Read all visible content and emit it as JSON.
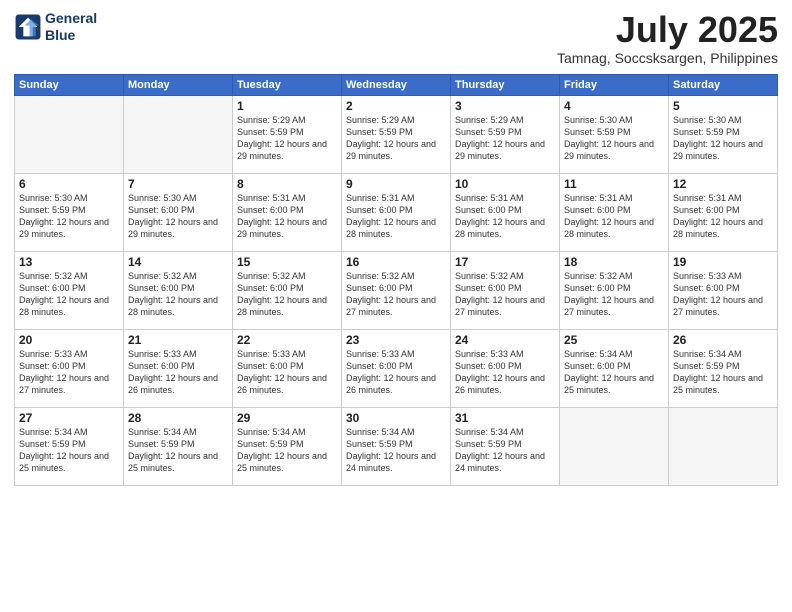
{
  "logo": {
    "line1": "General",
    "line2": "Blue"
  },
  "title": "July 2025",
  "location": "Tamnag, Soccsksargen, Philippines",
  "header_days": [
    "Sunday",
    "Monday",
    "Tuesday",
    "Wednesday",
    "Thursday",
    "Friday",
    "Saturday"
  ],
  "weeks": [
    [
      {
        "day": "",
        "info": ""
      },
      {
        "day": "",
        "info": ""
      },
      {
        "day": "1",
        "info": "Sunrise: 5:29 AM\nSunset: 5:59 PM\nDaylight: 12 hours\nand 29 minutes."
      },
      {
        "day": "2",
        "info": "Sunrise: 5:29 AM\nSunset: 5:59 PM\nDaylight: 12 hours\nand 29 minutes."
      },
      {
        "day": "3",
        "info": "Sunrise: 5:29 AM\nSunset: 5:59 PM\nDaylight: 12 hours\nand 29 minutes."
      },
      {
        "day": "4",
        "info": "Sunrise: 5:30 AM\nSunset: 5:59 PM\nDaylight: 12 hours\nand 29 minutes."
      },
      {
        "day": "5",
        "info": "Sunrise: 5:30 AM\nSunset: 5:59 PM\nDaylight: 12 hours\nand 29 minutes."
      }
    ],
    [
      {
        "day": "6",
        "info": "Sunrise: 5:30 AM\nSunset: 5:59 PM\nDaylight: 12 hours\nand 29 minutes."
      },
      {
        "day": "7",
        "info": "Sunrise: 5:30 AM\nSunset: 6:00 PM\nDaylight: 12 hours\nand 29 minutes."
      },
      {
        "day": "8",
        "info": "Sunrise: 5:31 AM\nSunset: 6:00 PM\nDaylight: 12 hours\nand 29 minutes."
      },
      {
        "day": "9",
        "info": "Sunrise: 5:31 AM\nSunset: 6:00 PM\nDaylight: 12 hours\nand 28 minutes."
      },
      {
        "day": "10",
        "info": "Sunrise: 5:31 AM\nSunset: 6:00 PM\nDaylight: 12 hours\nand 28 minutes."
      },
      {
        "day": "11",
        "info": "Sunrise: 5:31 AM\nSunset: 6:00 PM\nDaylight: 12 hours\nand 28 minutes."
      },
      {
        "day": "12",
        "info": "Sunrise: 5:31 AM\nSunset: 6:00 PM\nDaylight: 12 hours\nand 28 minutes."
      }
    ],
    [
      {
        "day": "13",
        "info": "Sunrise: 5:32 AM\nSunset: 6:00 PM\nDaylight: 12 hours\nand 28 minutes."
      },
      {
        "day": "14",
        "info": "Sunrise: 5:32 AM\nSunset: 6:00 PM\nDaylight: 12 hours\nand 28 minutes."
      },
      {
        "day": "15",
        "info": "Sunrise: 5:32 AM\nSunset: 6:00 PM\nDaylight: 12 hours\nand 28 minutes."
      },
      {
        "day": "16",
        "info": "Sunrise: 5:32 AM\nSunset: 6:00 PM\nDaylight: 12 hours\nand 27 minutes."
      },
      {
        "day": "17",
        "info": "Sunrise: 5:32 AM\nSunset: 6:00 PM\nDaylight: 12 hours\nand 27 minutes."
      },
      {
        "day": "18",
        "info": "Sunrise: 5:32 AM\nSunset: 6:00 PM\nDaylight: 12 hours\nand 27 minutes."
      },
      {
        "day": "19",
        "info": "Sunrise: 5:33 AM\nSunset: 6:00 PM\nDaylight: 12 hours\nand 27 minutes."
      }
    ],
    [
      {
        "day": "20",
        "info": "Sunrise: 5:33 AM\nSunset: 6:00 PM\nDaylight: 12 hours\nand 27 minutes."
      },
      {
        "day": "21",
        "info": "Sunrise: 5:33 AM\nSunset: 6:00 PM\nDaylight: 12 hours\nand 26 minutes."
      },
      {
        "day": "22",
        "info": "Sunrise: 5:33 AM\nSunset: 6:00 PM\nDaylight: 12 hours\nand 26 minutes."
      },
      {
        "day": "23",
        "info": "Sunrise: 5:33 AM\nSunset: 6:00 PM\nDaylight: 12 hours\nand 26 minutes."
      },
      {
        "day": "24",
        "info": "Sunrise: 5:33 AM\nSunset: 6:00 PM\nDaylight: 12 hours\nand 26 minutes."
      },
      {
        "day": "25",
        "info": "Sunrise: 5:34 AM\nSunset: 6:00 PM\nDaylight: 12 hours\nand 25 minutes."
      },
      {
        "day": "26",
        "info": "Sunrise: 5:34 AM\nSunset: 5:59 PM\nDaylight: 12 hours\nand 25 minutes."
      }
    ],
    [
      {
        "day": "27",
        "info": "Sunrise: 5:34 AM\nSunset: 5:59 PM\nDaylight: 12 hours\nand 25 minutes."
      },
      {
        "day": "28",
        "info": "Sunrise: 5:34 AM\nSunset: 5:59 PM\nDaylight: 12 hours\nand 25 minutes."
      },
      {
        "day": "29",
        "info": "Sunrise: 5:34 AM\nSunset: 5:59 PM\nDaylight: 12 hours\nand 25 minutes."
      },
      {
        "day": "30",
        "info": "Sunrise: 5:34 AM\nSunset: 5:59 PM\nDaylight: 12 hours\nand 24 minutes."
      },
      {
        "day": "31",
        "info": "Sunrise: 5:34 AM\nSunset: 5:59 PM\nDaylight: 12 hours\nand 24 minutes."
      },
      {
        "day": "",
        "info": ""
      },
      {
        "day": "",
        "info": ""
      }
    ]
  ]
}
